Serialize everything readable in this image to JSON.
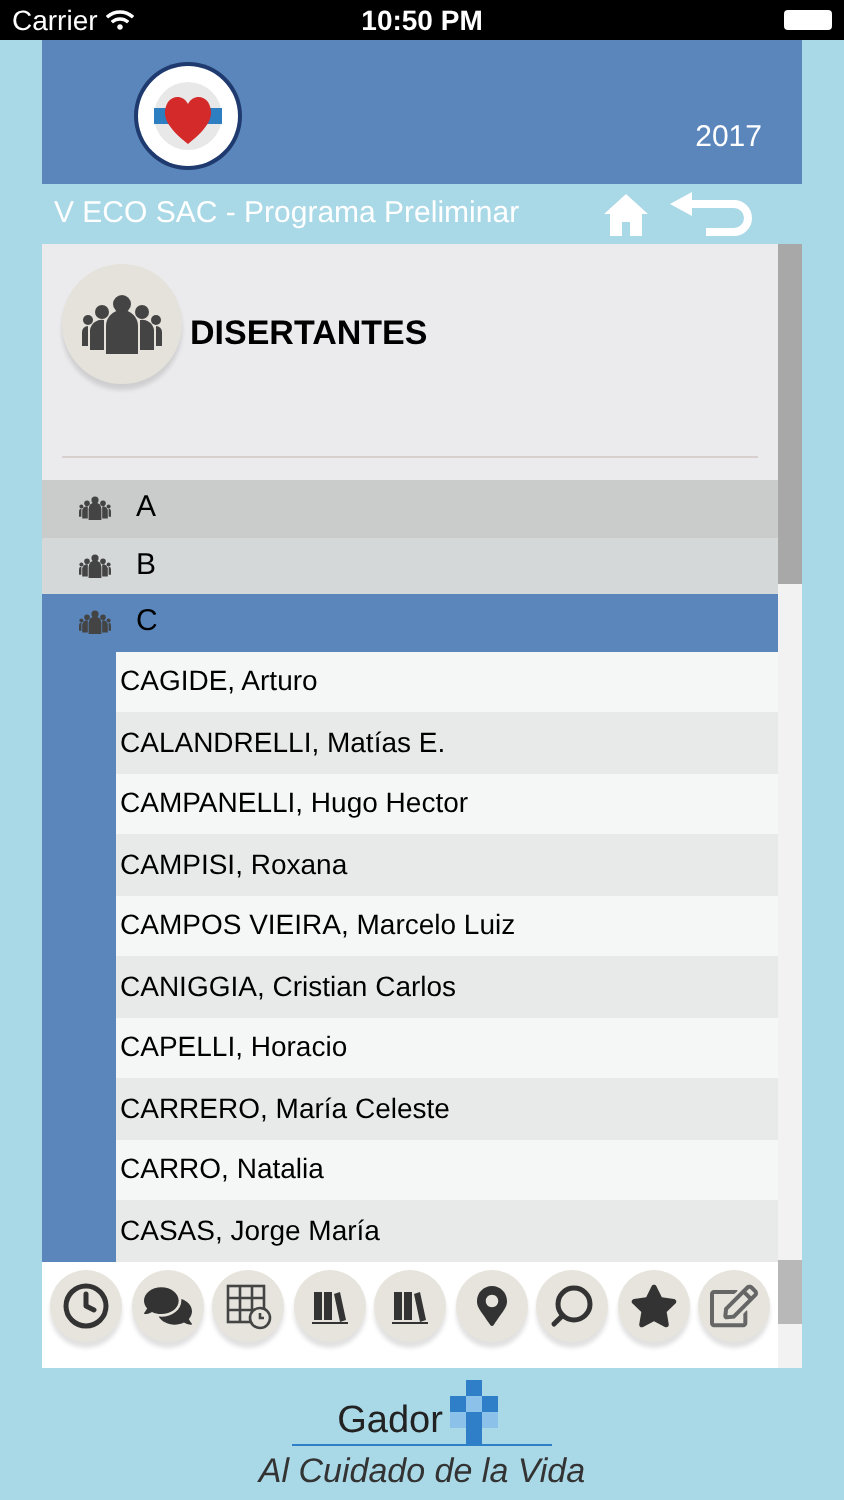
{
  "status_bar": {
    "carrier": "Carrier",
    "time": "10:50 PM"
  },
  "header": {
    "year": "2017"
  },
  "nav": {
    "title": "V ECO SAC - Programa Preliminar"
  },
  "section": {
    "title": "DISERTANTES"
  },
  "letters": [
    {
      "label": "A",
      "selected": false
    },
    {
      "label": "B",
      "selected": false
    },
    {
      "label": "C",
      "selected": true
    }
  ],
  "speakers": [
    "CAGIDE, Arturo",
    "CALANDRELLI, Matías E.",
    "CAMPANELLI, Hugo Hector",
    "CAMPISI, Roxana",
    "CAMPOS VIEIRA, Marcelo Luiz",
    "CANIGGIA, Cristian Carlos",
    "CAPELLI, Horacio",
    "CARRERO, María Celeste",
    "CARRO, Natalia",
    "CASAS, Jorge María"
  ],
  "footer": {
    "brand": "Gador",
    "slogan": "Al Cuidado de la Vida"
  }
}
